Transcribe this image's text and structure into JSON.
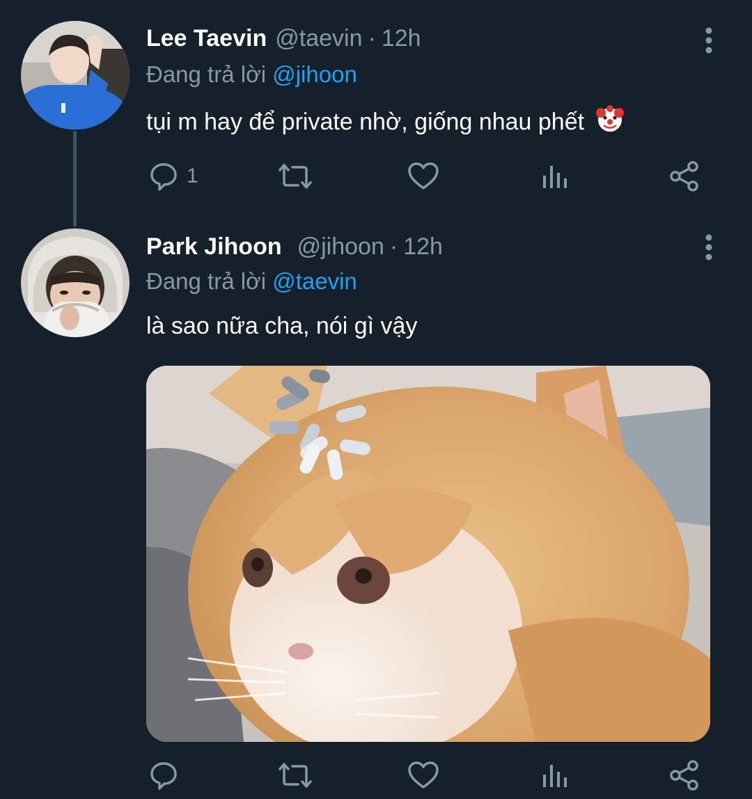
{
  "tweets": [
    {
      "author_name": "Lee Taevin",
      "author_handle": "@taevin",
      "separator": "·",
      "time": "12h",
      "reply_prefix": "Đang trả lời",
      "reply_to": "@jihoon",
      "text": "tụi m hay để private nhờ, giống nhau phết",
      "emoji": "clown-face-emoji",
      "reply_count": "1",
      "avatar": "avatar-boy-blue-hoodie"
    },
    {
      "author_name": "Park Jihoon",
      "author_handle": "@jihoon",
      "separator": "·",
      "time": "12h",
      "reply_prefix": "Đang trả lời",
      "reply_to": "@taevin",
      "text": "là sao nữa cha, nói gì vậy",
      "reply_count": "",
      "avatar": "avatar-boy-hood-mask",
      "media": "orange-white-cat-with-loading-spinner"
    }
  ],
  "icons": {
    "reply": "speech-bubble-icon",
    "retweet": "retweet-icon",
    "like": "heart-icon",
    "analytics": "bar-chart-icon",
    "share": "share-icon",
    "more": "vertical-dots-icon"
  },
  "colors": {
    "background": "#15202b",
    "primary_text": "#ffffff",
    "secondary_text": "#8899a6",
    "link": "#1da1f2",
    "thread_line": "#3d5466"
  }
}
